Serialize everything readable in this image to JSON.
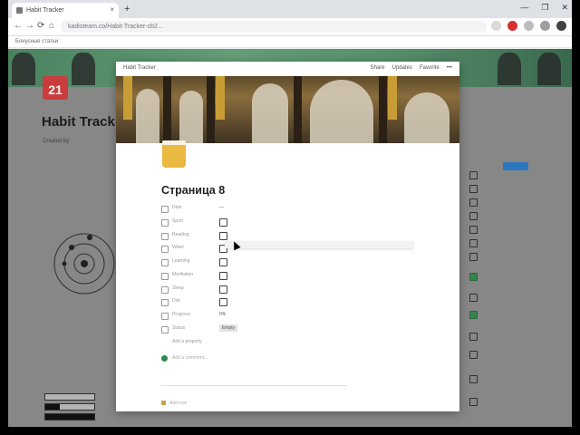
{
  "browser": {
    "tab_title": "Habit Tracker",
    "tab_close": "×",
    "new_tab": "+",
    "window_controls": [
      "—",
      "❐",
      "✕"
    ],
    "nav": {
      "back": "←",
      "forward": "→",
      "reload": "⟳",
      "home": "⌂"
    },
    "url": "kadisteam.co/Habit-Tracker-cb2...",
    "bookmark": "Бонусные статьи",
    "extension_colors": [
      "#d9d9d9",
      "#d32f2f",
      "#bdbdbd",
      "#9e9e9e",
      "#424242"
    ]
  },
  "background_page": {
    "title": "Habit Track",
    "calendar_day": "21",
    "meta": "Created by"
  },
  "modal": {
    "breadcrumb": "Habit Tracker",
    "actions": [
      "Share",
      "Updates",
      "Favorite",
      "•••"
    ],
    "page_title": "Страница 8",
    "properties": [
      {
        "name": "Date",
        "type": "date",
        "value": "—"
      },
      {
        "name": "Sport",
        "type": "checkbox"
      },
      {
        "name": "Reading",
        "type": "checkbox"
      },
      {
        "name": "Water",
        "type": "checkbox"
      },
      {
        "name": "Learning",
        "type": "checkbox"
      },
      {
        "name": "Meditation",
        "type": "checkbox"
      },
      {
        "name": "Sleep",
        "type": "checkbox"
      },
      {
        "name": "Diet",
        "type": "checkbox"
      },
      {
        "name": "Progress",
        "type": "number",
        "value": "0%"
      },
      {
        "name": "Status",
        "type": "select",
        "value": "Empty"
      },
      {
        "name": "Add a property",
        "type": "add"
      }
    ],
    "add_comment": "Add a comment...",
    "bottom_hint": "Add icon"
  },
  "colors": {
    "accent_blue": "#2d7ec9",
    "done_green": "#3c8a52",
    "calendar_red": "#d64040"
  }
}
